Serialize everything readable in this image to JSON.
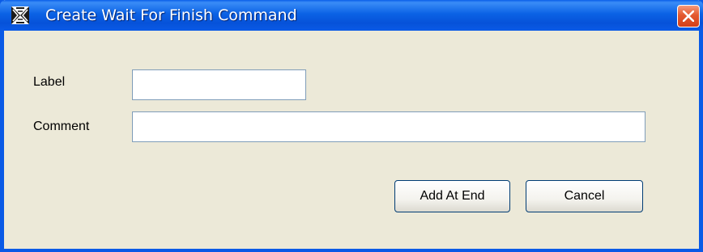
{
  "window": {
    "title": "Create Wait For Finish Command",
    "icon": "app-icon",
    "close_icon": "close-icon"
  },
  "form": {
    "label_field": {
      "label": "Label",
      "value": "",
      "placeholder": ""
    },
    "comment_field": {
      "label": "Comment",
      "value": "",
      "placeholder": ""
    }
  },
  "buttons": {
    "add_at_end": "Add At End",
    "cancel": "Cancel"
  },
  "colors": {
    "titlebar": "#0a5ae6",
    "close_button": "#e3592f",
    "dialog_background": "#ece9d8",
    "input_border": "#7f9db9"
  }
}
